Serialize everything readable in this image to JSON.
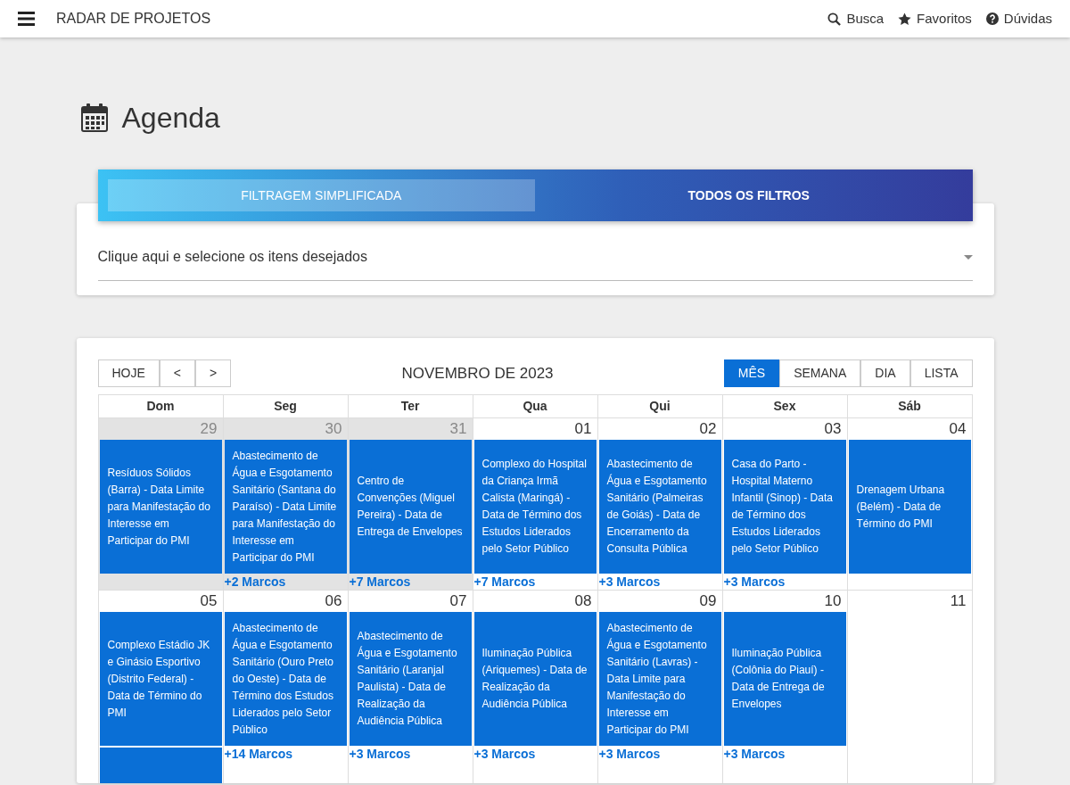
{
  "navbar": {
    "title": "RADAR DE PROJETOS",
    "links": [
      {
        "kind": "search",
        "label": "Busca"
      },
      {
        "kind": "star",
        "label": "Favoritos"
      },
      {
        "kind": "help",
        "label": "Dúvidas"
      }
    ]
  },
  "page_title": "Agenda",
  "filter": {
    "tabs": [
      {
        "label": "FILTRAGEM SIMPLIFICADA",
        "selected": true
      },
      {
        "label": "TODOS OS FILTROS",
        "selected": false
      }
    ],
    "select_placeholder": "Clique aqui e selecione os itens desejados"
  },
  "calendar": {
    "nav_buttons": [
      "HOJE",
      "<",
      ">"
    ],
    "title": "NOVEMBRO DE 2023",
    "views": [
      {
        "label": "MÊS",
        "selected": true
      },
      {
        "label": "SEMANA",
        "selected": false
      },
      {
        "label": "DIA",
        "selected": false
      },
      {
        "label": "LISTA",
        "selected": false
      }
    ],
    "weekdays": [
      "Dom",
      "Seg",
      "Ter",
      "Qua",
      "Qui",
      "Sex",
      "Sáb"
    ],
    "weeks": [
      [
        {
          "day": "29",
          "past": true,
          "event": "Resíduos Sólidos (Barra) - Data Limite para Manifestação do Interesse em Participar do PMI"
        },
        {
          "day": "30",
          "past": true,
          "event": "Abastecimento de Água e Esgotamento Sanitário (Santana do Paraíso) - Data Limite para Manifestação do Interesse em Participar do PMI",
          "more": "+2 Marcos"
        },
        {
          "day": "31",
          "past": true,
          "event": "Centro de Convenções (Miguel Pereira) - Data de Entrega de Envelopes",
          "more": "+7 Marcos"
        },
        {
          "day": "01",
          "past": false,
          "event": "Complexo do Hospital da Criança Irmã Calista (Maringá) - Data de Término dos Estudos Liderados pelo Setor Público",
          "more": "+7 Marcos"
        },
        {
          "day": "02",
          "past": false,
          "event": "Abastecimento de Água e Esgotamento Sanitário (Palmeiras de Goiás) - Data de Encerramento da Consulta Pública",
          "more": "+3 Marcos"
        },
        {
          "day": "03",
          "past": false,
          "event": "Casa do Parto - Hospital Materno Infantil (Sinop) - Data de Término dos Estudos Liderados pelo Setor Público",
          "more": "+3 Marcos"
        },
        {
          "day": "04",
          "past": false,
          "event": "Drenagem Urbana (Belém) - Data de Término do PMI"
        }
      ],
      [
        {
          "day": "05",
          "past": false,
          "event": "Complexo Estádio JK e Ginásio Esportivo (Distrito Federal) - Data de Término do PMI",
          "second_event_cut": true
        },
        {
          "day": "06",
          "past": false,
          "event": "Abastecimento de Água e Esgotamento Sanitário (Ouro Preto do Oeste) - Data de Término dos Estudos Liderados pelo Setor Público",
          "more": "+14 Marcos"
        },
        {
          "day": "07",
          "past": false,
          "event": "Abastecimento de Água e Esgotamento Sanitário (Laranjal Paulista) - Data de Realização da Audiência Pública",
          "more": "+3 Marcos"
        },
        {
          "day": "08",
          "past": false,
          "event": "Iluminação Pública (Ariquemes) - Data de Realização da Audiência Pública",
          "more": "+3 Marcos"
        },
        {
          "day": "09",
          "past": false,
          "event": "Abastecimento de Água e Esgotamento Sanitário (Lavras) - Data Limite para Manifestação do Interesse em Participar do PMI",
          "more": "+3 Marcos"
        },
        {
          "day": "10",
          "past": false,
          "event": "Iluminação Pública (Colônia do Piauí) - Data de Entrega de Envelopes",
          "more": "+3 Marcos"
        },
        {
          "day": "11",
          "past": false
        }
      ]
    ]
  }
}
